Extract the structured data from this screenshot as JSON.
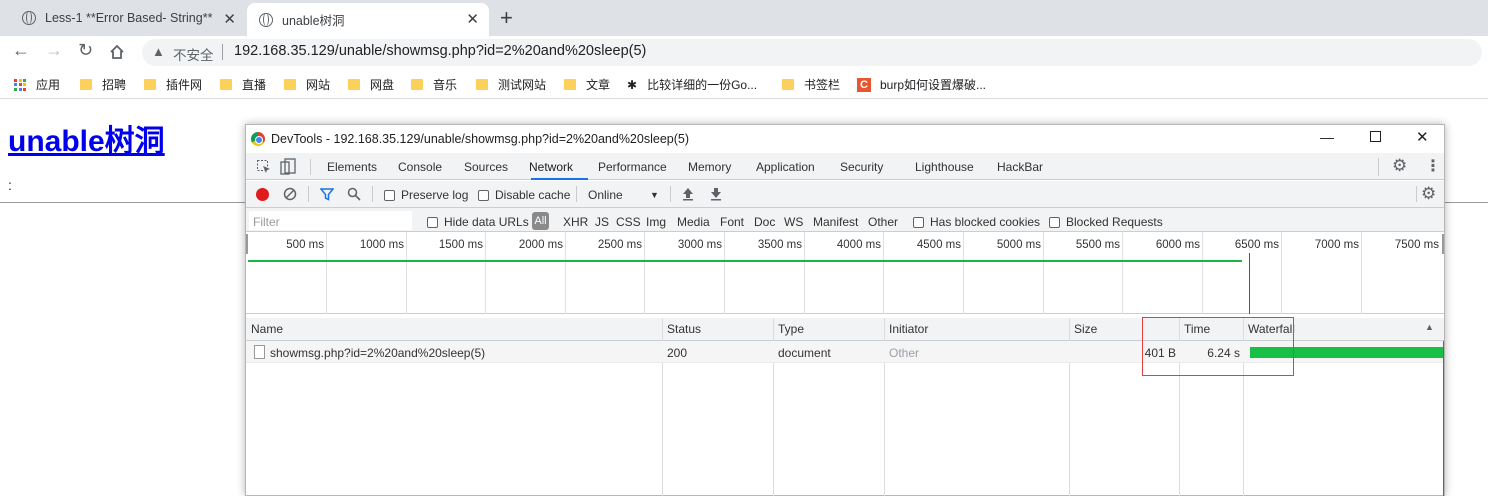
{
  "browser": {
    "tabs": [
      {
        "title": "Less-1 **Error Based- String**",
        "active": false
      },
      {
        "title": "unable树洞",
        "active": true
      }
    ],
    "not_secure_label": "不安全",
    "url": "192.168.35.129/unable/showmsg.php?id=2%20and%20sleep(5)",
    "bookmarks": [
      "应用",
      "招聘",
      "插件网",
      "直播",
      "网站",
      "网盘",
      "音乐",
      "测试网站",
      "文章",
      "比较详细的一份Go...",
      "书签栏",
      "burp如何设置爆破..."
    ]
  },
  "page": {
    "title": "unable树洞",
    "body_text": ":"
  },
  "devtools": {
    "window_title": "DevTools - 192.168.35.129/unable/showmsg.php?id=2%20and%20sleep(5)",
    "panels": [
      "Elements",
      "Console",
      "Sources",
      "Network",
      "Performance",
      "Memory",
      "Application",
      "Security",
      "Lighthouse",
      "HackBar"
    ],
    "active_panel": "Network",
    "toolbar": {
      "preserve_log": "Preserve log",
      "disable_cache": "Disable cache",
      "throttle": "Online"
    },
    "filter": {
      "placeholder": "Filter",
      "hide_data_urls": "Hide data URLs",
      "types": [
        "All",
        "XHR",
        "JS",
        "CSS",
        "Img",
        "Media",
        "Font",
        "Doc",
        "WS",
        "Manifest",
        "Other"
      ],
      "has_blocked_cookies": "Has blocked cookies",
      "blocked_requests": "Blocked Requests"
    },
    "overview_ticks": [
      "500 ms",
      "1000 ms",
      "1500 ms",
      "2000 ms",
      "2500 ms",
      "3000 ms",
      "3500 ms",
      "4000 ms",
      "4500 ms",
      "5000 ms",
      "5500 ms",
      "6000 ms",
      "6500 ms",
      "7000 ms",
      "7500 ms"
    ],
    "columns": [
      "Name",
      "Status",
      "Type",
      "Initiator",
      "Size",
      "Time",
      "Waterfall"
    ],
    "requests": [
      {
        "name": "showmsg.php?id=2%20and%20sleep(5)",
        "status": "200",
        "type": "document",
        "initiator": "Other",
        "size": "401 B",
        "time": "6.24 s"
      }
    ]
  },
  "colors": {
    "link": "#0000ee",
    "accent": "#1a73e8",
    "waterfall": "#17bf44",
    "highlight": "#e04040"
  }
}
